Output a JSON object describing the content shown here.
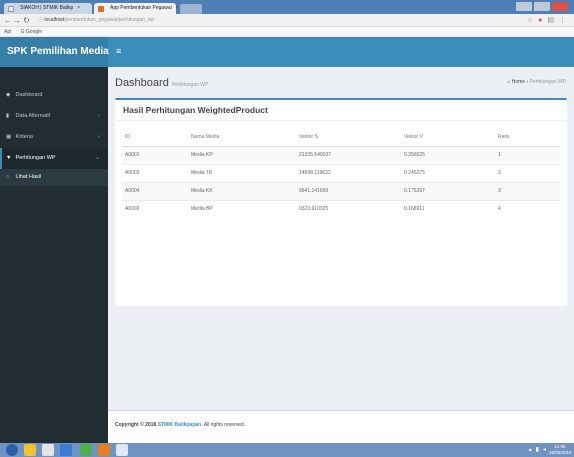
{
  "browser": {
    "tabs": [
      {
        "label": "SIAKOH | STMIK Balikp"
      },
      {
        "label": "App Pembentukan Pegawai"
      }
    ],
    "tab_close": "×",
    "address_host": "localhost",
    "address_path": "/pembentukan_pegawai/perhitungan_wp",
    "bookmarks": [
      "Apl",
      "G Google"
    ]
  },
  "app": {
    "brand": "SPK Pemilihan Media",
    "menu_toggle": "≡"
  },
  "sidebar": {
    "items": [
      {
        "label": "Dashboard",
        "icon": "dashboard-icon",
        "glyph": "◆"
      },
      {
        "label": "Data Alternatif",
        "icon": "data-icon",
        "glyph": "▮",
        "chevron": "‹"
      },
      {
        "label": "Kriteria",
        "icon": "list-icon",
        "glyph": "▦",
        "chevron": "‹"
      },
      {
        "label": "Perhitungan WP",
        "icon": "chart-icon",
        "glyph": "▼",
        "chevron": "⌄"
      }
    ],
    "submenu": [
      {
        "label": "Lihat Hasil",
        "icon": "circle-icon",
        "glyph": "○"
      }
    ]
  },
  "page": {
    "title": "Dashboard",
    "subtitle": "Perhitungan WP",
    "breadcrumb_home": "Home",
    "breadcrumb_sep": "›",
    "breadcrumb_current": "Perhitungan WP"
  },
  "results": {
    "title": "Hasil Perhitungan WeightedProduct",
    "columns": [
      "ID",
      "Nama Media",
      "Vektor S",
      "Vektor V",
      "Rank"
    ],
    "rows": [
      [
        "A0001",
        "Media KP",
        "21335.540037",
        "0.356525",
        "1"
      ],
      [
        "A0003",
        "Media TK",
        "14698.119632",
        "0.245275",
        "2"
      ],
      [
        "A0004",
        "Media KK",
        "9641.141659",
        "0.175297",
        "3"
      ],
      [
        "A0002",
        "Media BP",
        "9323.610325",
        "0.168911",
        "4"
      ]
    ]
  },
  "footer": {
    "prefix": "Copyright © 2018",
    "link": "STMIK Balikpapan.",
    "suffix": "All rights reserved."
  },
  "taskbar": {
    "time": "11:06",
    "date": "26/05/2018"
  },
  "colors": {
    "primary": "#3c8dbc",
    "sidebar_bg": "#222d32",
    "content_bg": "#ecf0f5"
  }
}
